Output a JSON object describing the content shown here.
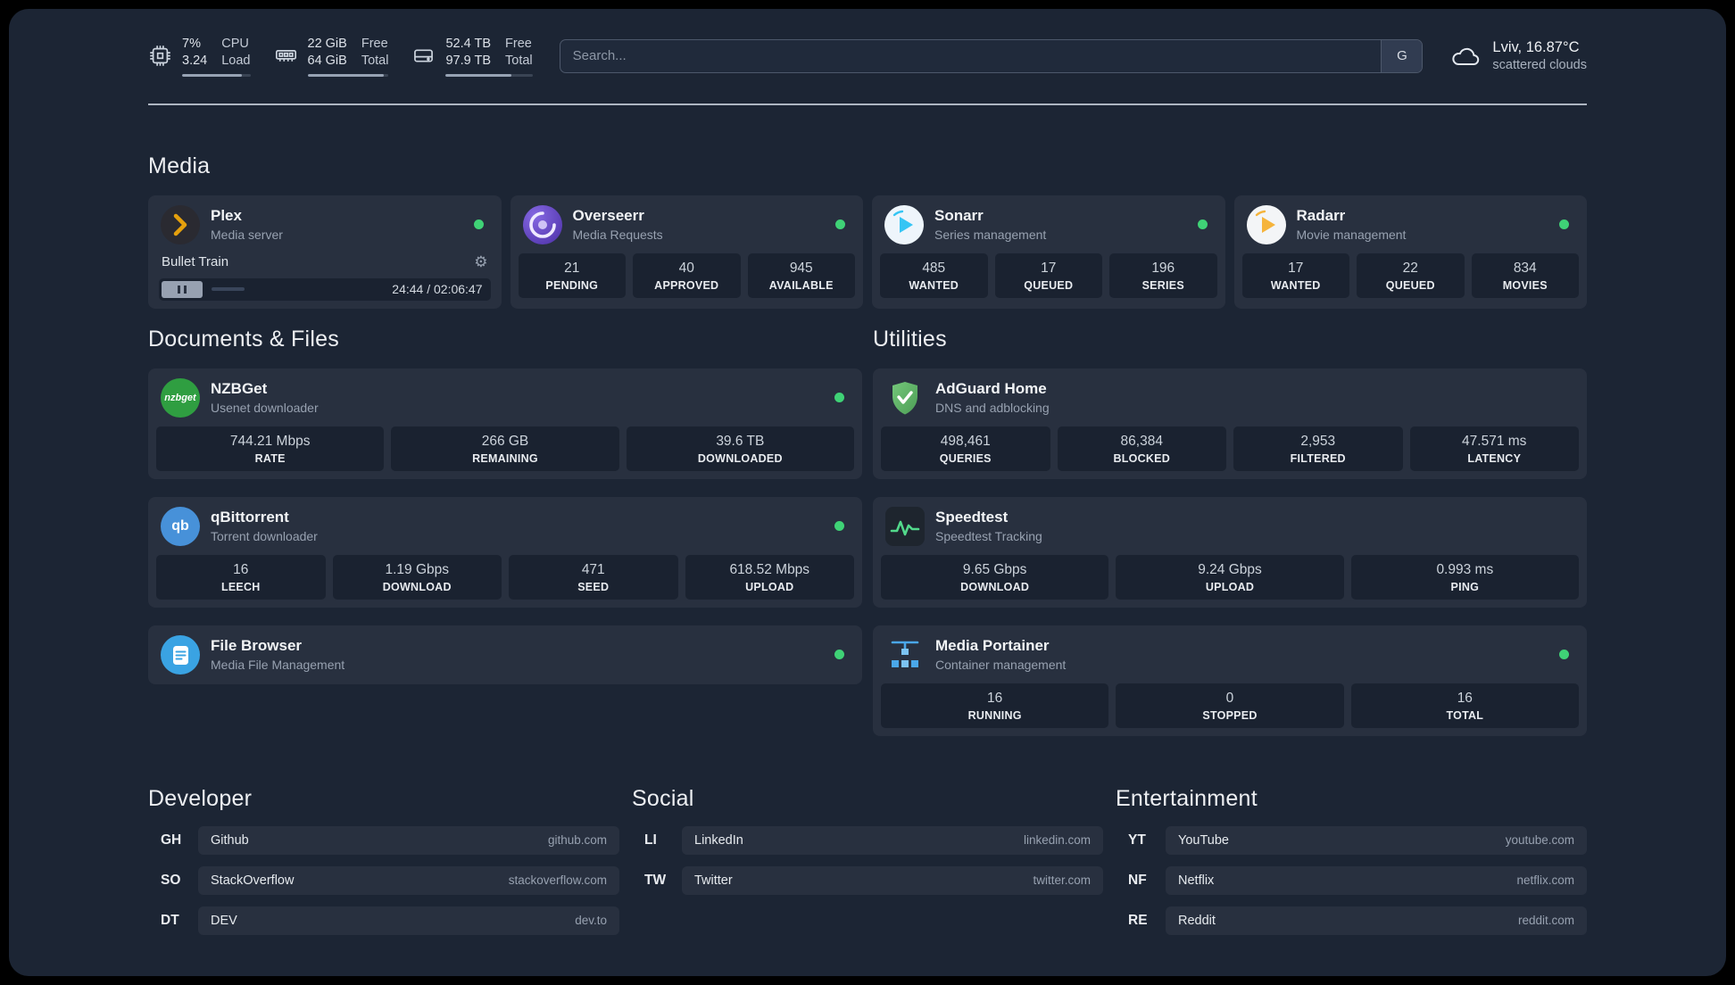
{
  "colors": {
    "status_online": "#3fd276",
    "accent_plex": "#e5a00d",
    "accent_overseerr": "#6246c9",
    "accent_sonarr": "#35c5f4",
    "accent_radarr": "#f5b43c",
    "accent_nzbget": "#2f9e41",
    "accent_qbittorrent": "#4791d9",
    "accent_filebrowser": "#3aa3e3",
    "accent_adguard": "#5fb868",
    "accent_speedtest": "#52d98b",
    "accent_portainer": "#4aa7e9"
  },
  "icons": {
    "gear": "⚙",
    "search_button": "G"
  },
  "topbar": {
    "resources": [
      {
        "name": "cpu",
        "value_top": "7%",
        "value_bottom": "3.24",
        "label_top": "CPU",
        "label_bottom": "Load",
        "bar_pct": 88
      },
      {
        "name": "memory",
        "value_top": "22 GiB",
        "value_bottom": "64 GiB",
        "label_top": "Free",
        "label_bottom": "Total",
        "bar_pct": 94
      },
      {
        "name": "disk",
        "value_top": "52.4 TB",
        "value_bottom": "97.9 TB",
        "label_top": "Free",
        "label_bottom": "Total",
        "bar_pct": 76
      }
    ],
    "search": {
      "placeholder": "Search..."
    },
    "weather": {
      "location": "Lviv, 16.87°C",
      "condition": "scattered clouds"
    }
  },
  "media": {
    "heading": "Media",
    "cards": {
      "plex": {
        "name": "Plex",
        "desc": "Media server",
        "status": "online",
        "now_playing": "Bullet Train",
        "time_display": "24:44 / 02:06:47",
        "progress_pct": 19
      },
      "overseerr": {
        "name": "Overseerr",
        "desc": "Media Requests",
        "status": "online",
        "stats": [
          {
            "value": "21",
            "label": "PENDING"
          },
          {
            "value": "40",
            "label": "APPROVED"
          },
          {
            "value": "945",
            "label": "AVAILABLE"
          }
        ]
      },
      "sonarr": {
        "name": "Sonarr",
        "desc": "Series management",
        "status": "online",
        "stats": [
          {
            "value": "485",
            "label": "WANTED"
          },
          {
            "value": "17",
            "label": "QUEUED"
          },
          {
            "value": "196",
            "label": "SERIES"
          }
        ]
      },
      "radarr": {
        "name": "Radarr",
        "desc": "Movie management",
        "status": "online",
        "stats": [
          {
            "value": "17",
            "label": "WANTED"
          },
          {
            "value": "22",
            "label": "QUEUED"
          },
          {
            "value": "834",
            "label": "MOVIES"
          }
        ]
      }
    }
  },
  "documents": {
    "heading": "Documents & Files",
    "cards": {
      "nzbget": {
        "name": "NZBGet",
        "desc": "Usenet downloader",
        "status": "online",
        "icon_text": "nzbget",
        "stats": [
          {
            "value": "744.21 Mbps",
            "label": "RATE"
          },
          {
            "value": "266 GB",
            "label": "REMAINING"
          },
          {
            "value": "39.6 TB",
            "label": "DOWNLOADED"
          }
        ]
      },
      "qbittorrent": {
        "name": "qBittorrent",
        "desc": "Torrent downloader",
        "status": "online",
        "icon_text": "qb",
        "stats": [
          {
            "value": "16",
            "label": "LEECH"
          },
          {
            "value": "1.19 Gbps",
            "label": "DOWNLOAD"
          },
          {
            "value": "471",
            "label": "SEED"
          },
          {
            "value": "618.52 Mbps",
            "label": "UPLOAD"
          }
        ]
      },
      "filebrowser": {
        "name": "File Browser",
        "desc": "Media File Management",
        "status": "online"
      }
    }
  },
  "utilities": {
    "heading": "Utilities",
    "cards": {
      "adguard": {
        "name": "AdGuard Home",
        "desc": "DNS and adblocking",
        "stats": [
          {
            "value": "498,461",
            "label": "QUERIES"
          },
          {
            "value": "86,384",
            "label": "BLOCKED"
          },
          {
            "value": "2,953",
            "label": "FILTERED"
          },
          {
            "value": "47.571 ms",
            "label": "LATENCY"
          }
        ]
      },
      "speedtest": {
        "name": "Speedtest",
        "desc": "Speedtest Tracking",
        "stats": [
          {
            "value": "9.65 Gbps",
            "label": "DOWNLOAD"
          },
          {
            "value": "9.24 Gbps",
            "label": "UPLOAD"
          },
          {
            "value": "0.993 ms",
            "label": "PING"
          }
        ]
      },
      "portainer": {
        "name": "Media Portainer",
        "desc": "Container management",
        "status": "online",
        "stats": [
          {
            "value": "16",
            "label": "RUNNING"
          },
          {
            "value": "0",
            "label": "STOPPED"
          },
          {
            "value": "16",
            "label": "TOTAL"
          }
        ]
      }
    }
  },
  "bookmarks": {
    "developer": {
      "heading": "Developer",
      "items": [
        {
          "abbr": "GH",
          "name": "Github",
          "url": "github.com"
        },
        {
          "abbr": "SO",
          "name": "StackOverflow",
          "url": "stackoverflow.com"
        },
        {
          "abbr": "DT",
          "name": "DEV",
          "url": "dev.to"
        }
      ]
    },
    "social": {
      "heading": "Social",
      "items": [
        {
          "abbr": "LI",
          "name": "LinkedIn",
          "url": "linkedin.com"
        },
        {
          "abbr": "TW",
          "name": "Twitter",
          "url": "twitter.com"
        }
      ]
    },
    "entertainment": {
      "heading": "Entertainment",
      "items": [
        {
          "abbr": "YT",
          "name": "YouTube",
          "url": "youtube.com"
        },
        {
          "abbr": "NF",
          "name": "Netflix",
          "url": "netflix.com"
        },
        {
          "abbr": "RE",
          "name": "Reddit",
          "url": "reddit.com"
        }
      ]
    }
  }
}
